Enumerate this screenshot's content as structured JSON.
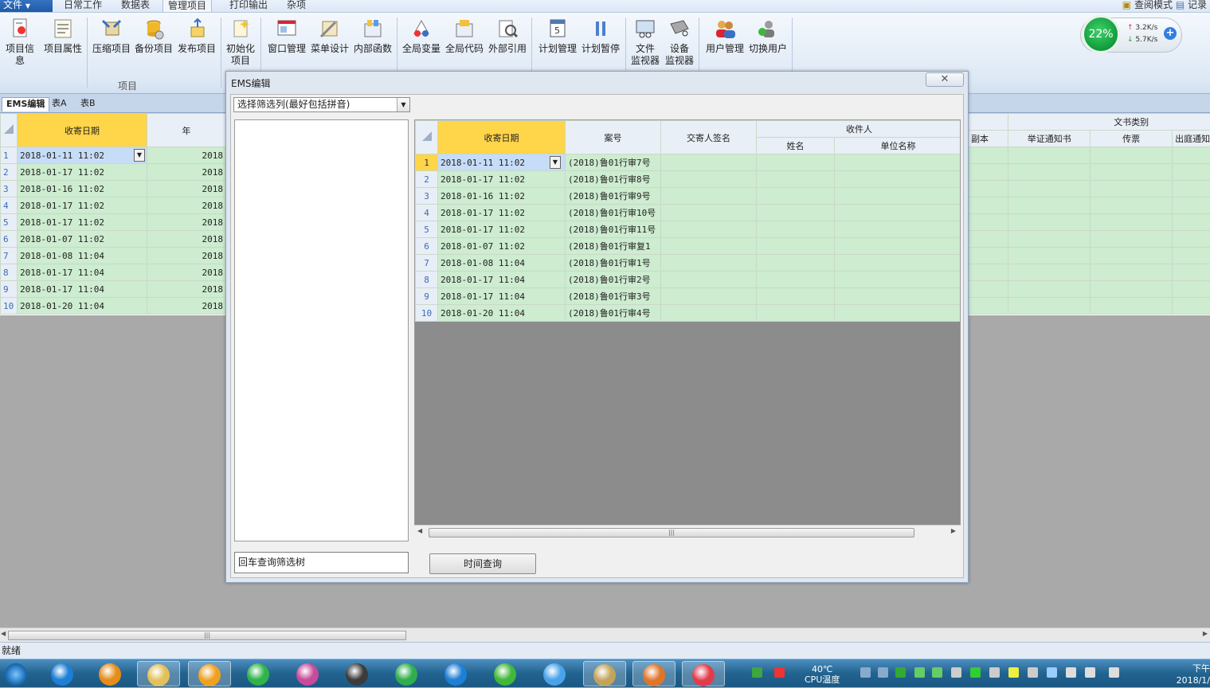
{
  "ribbon": {
    "file_label": "文件",
    "tabs": [
      "日常工作",
      "数据表",
      "管理项目",
      "打印输出",
      "杂项"
    ],
    "active_tab": "管理项目",
    "right_items": [
      "查阅模式",
      "记录"
    ],
    "group_label": "项目",
    "buttons": [
      {
        "label": "项目信息",
        "icon": "project-info-icon"
      },
      {
        "label": "项目属性",
        "icon": "project-properties-icon"
      },
      {
        "label": "压缩项目",
        "icon": "compress-icon"
      },
      {
        "label": "备份项目",
        "icon": "backup-icon"
      },
      {
        "label": "发布项目",
        "icon": "publish-icon"
      },
      {
        "label": "初始化项目",
        "line1": "初始化",
        "line2": "项目",
        "icon": "initialize-icon"
      },
      {
        "label": "窗口管理",
        "icon": "window-manage-icon"
      },
      {
        "label": "菜单设计",
        "icon": "menu-design-icon"
      },
      {
        "label": "内部函数",
        "icon": "functions-icon"
      },
      {
        "label": "全局变量",
        "icon": "global-variables-icon"
      },
      {
        "label": "全局代码",
        "icon": "global-code-icon"
      },
      {
        "label": "外部引用",
        "icon": "external-reference-icon"
      },
      {
        "label": "计划管理",
        "icon": "schedule-icon"
      },
      {
        "label": "计划暂停",
        "icon": "pause-icon"
      },
      {
        "label": "文件监视器",
        "line1": "文件",
        "line2": "监视器",
        "icon": "file-monitor-icon"
      },
      {
        "label": "设备监视器",
        "line1": "设备",
        "line2": "监视器",
        "icon": "device-monitor-icon"
      },
      {
        "label": "用户管理",
        "icon": "user-manage-icon"
      },
      {
        "label": "切换用户",
        "icon": "switch-user-icon"
      }
    ]
  },
  "speed_widget": {
    "cpu": "22%",
    "up": "3.2K/s",
    "down": "5.7K/s"
  },
  "doc_tabs": [
    "EMS编辑",
    "表A",
    "表B"
  ],
  "bg_grid": {
    "headers": [
      "收寄日期",
      "年"
    ],
    "right_group": "文书类别",
    "right_headers": [
      "副本",
      "举证通知书",
      "传票",
      "出庭通知"
    ],
    "rows": [
      [
        "2018-01-11  11:02",
        "2018"
      ],
      [
        "2018-01-17  11:02",
        "2018"
      ],
      [
        "2018-01-16  11:02",
        "2018"
      ],
      [
        "2018-01-17  11:02",
        "2018"
      ],
      [
        "2018-01-17  11:02",
        "2018"
      ],
      [
        "2018-01-07  11:02",
        "2018"
      ],
      [
        "2018-01-08  11:04",
        "2018"
      ],
      [
        "2018-01-17  11:04",
        "2018"
      ],
      [
        "2018-01-17  11:04",
        "2018"
      ],
      [
        "2018-01-20  11:04",
        "2018"
      ]
    ]
  },
  "dialog": {
    "title": "EMS编辑",
    "close_symbol": "✕",
    "combo_value": "选择筛选列(最好包括拼音)",
    "search_placeholder": "回车查询筛选树",
    "time_button": "时间查询",
    "grid": {
      "headers": [
        "收寄日期",
        "案号",
        "交寄人签名"
      ],
      "group": "收件人",
      "sub_headers": [
        "姓名",
        "单位名称"
      ],
      "rows": [
        [
          "2018-01-11  11:02",
          "(2018)鲁01行审7号"
        ],
        [
          "2018-01-17  11:02",
          "(2018)鲁01行审8号"
        ],
        [
          "2018-01-16  11:02",
          "(2018)鲁01行审9号"
        ],
        [
          "2018-01-17  11:02",
          "(2018)鲁01行审10号"
        ],
        [
          "2018-01-17  11:02",
          "(2018)鲁01行审11号"
        ],
        [
          "2018-01-07  11:02",
          "(2018)鲁01行审复1"
        ],
        [
          "2018-01-08  11:04",
          "(2018)鲁01行审1号"
        ],
        [
          "2018-01-17  11:04",
          "(2018)鲁01行审2号"
        ],
        [
          "2018-01-17  11:04",
          "(2018)鲁01行审3号"
        ],
        [
          "2018-01-20  11:04",
          "(2018)鲁01行审4号"
        ]
      ]
    }
  },
  "status_text": "就绪",
  "taskbar": {
    "apps": [
      "start-orb-icon",
      "ie-icon",
      "pinwheel-icon",
      "explorer-icon",
      "paint-icon",
      "green-app-icon",
      "color-wheel-icon",
      "terminal-icon",
      "refresh-app-icon",
      "ie2-icon",
      "iqiyi-icon",
      "bird-icon",
      "tools-icon",
      "fox-icon",
      "camera-icon"
    ],
    "temp": "40℃",
    "temp_label": "CPU温度",
    "clock_time": "下午",
    "clock_date": "2018/1/"
  }
}
